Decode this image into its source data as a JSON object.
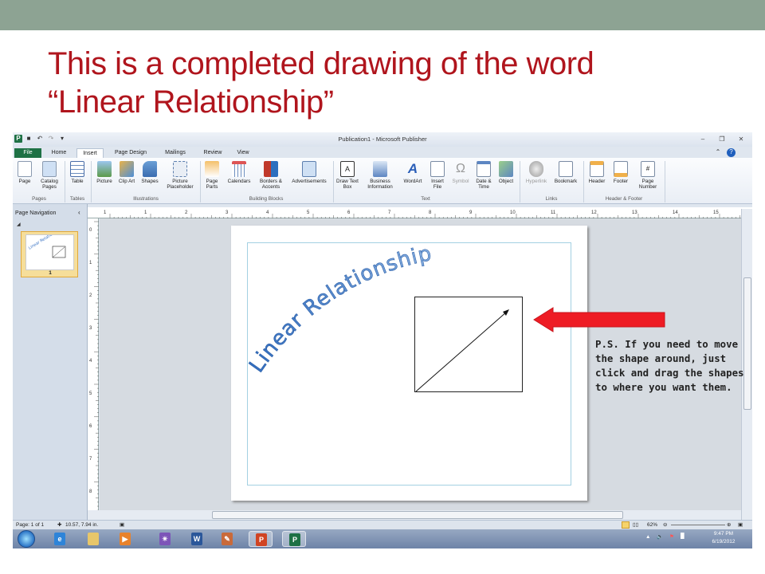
{
  "slide": {
    "title_line1": "This is a completed drawing of the word",
    "title_line2": "“Linear Relationship”",
    "note": "P.S. If you need to move the shape around, just click and drag the shapes to where you want them."
  },
  "app": {
    "window_title": "Publication1  -  Microsoft Publisher",
    "tabs": [
      "File",
      "Home",
      "Insert",
      "Page Design",
      "Mailings",
      "Review",
      "View"
    ],
    "active_tab": "Insert",
    "ribbon_groups": {
      "pages": {
        "label": "Pages",
        "buttons": [
          "Page",
          "Catalog Pages"
        ]
      },
      "tables": {
        "label": "Tables",
        "buttons": [
          "Table"
        ]
      },
      "illustrations": {
        "label": "Illustrations",
        "buttons": [
          "Picture",
          "Clip Art",
          "Shapes",
          "Picture Placeholder"
        ]
      },
      "building_blocks": {
        "label": "Building Blocks",
        "buttons": [
          "Page Parts",
          "Calendars",
          "Borders & Accents",
          "Advertisements"
        ]
      },
      "text": {
        "label": "Text",
        "buttons": [
          "Draw Text Box",
          "Business Information",
          "WordArt",
          "Insert File",
          "Symbol",
          "Date & Time",
          "Object"
        ]
      },
      "links": {
        "label": "Links",
        "buttons": [
          "Hyperlink",
          "Bookmark"
        ]
      },
      "header_footer": {
        "label": "Header & Footer",
        "buttons": [
          "Header",
          "Footer",
          "Page Number"
        ]
      }
    },
    "nav_pane": {
      "title": "Page Navigation",
      "page_number": "1"
    },
    "document": {
      "wordart_text": "Linear Relationship"
    },
    "status": {
      "page": "Page: 1 of 1",
      "position": "10.57, 7.94 in.",
      "zoom": "62%"
    },
    "tray": {
      "time": "9:47 PM",
      "date": "6/19/2012"
    },
    "hruler_ticks": [
      "1",
      "1",
      "2",
      "3",
      "4",
      "5",
      "6",
      "7",
      "8",
      "9",
      "10",
      "11",
      "12",
      "13",
      "14",
      "15"
    ],
    "vruler_ticks": [
      "0",
      "1",
      "2",
      "3",
      "4",
      "5",
      "6",
      "7",
      "8"
    ]
  },
  "colors": {
    "title": "#b0151d",
    "wordart_gradient_start": "#2f6bbd",
    "wordart_gradient_end": "#8db3e2",
    "arrow": "#ee1c24",
    "file_tab": "#1e7145"
  }
}
